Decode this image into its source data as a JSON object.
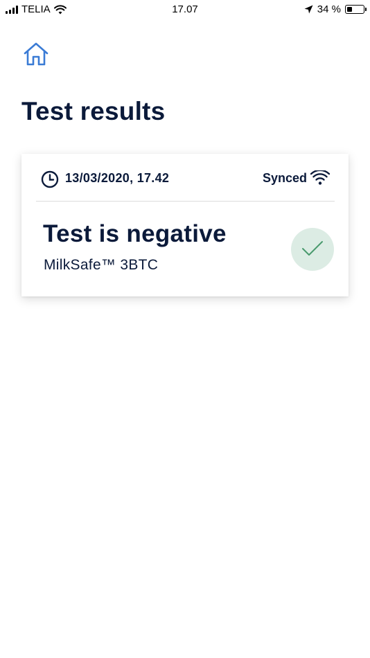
{
  "status_bar": {
    "carrier": "TELIA",
    "time": "17.07",
    "battery_text": "34 %",
    "battery_level": 0.34,
    "icons": [
      "signal-icon",
      "wifi-icon",
      "location-arrow-icon",
      "battery-icon"
    ]
  },
  "nav": {
    "home_icon": "home-icon"
  },
  "page": {
    "title": "Test results"
  },
  "result_card": {
    "timestamp": "13/03/2020, 17.42",
    "sync_status": "Synced",
    "result": "Test is negative",
    "product": "MilkSafe™ 3BTC",
    "icons": [
      "clock-icon",
      "wifi-icon",
      "checkmark-icon"
    ]
  },
  "colors": {
    "title_text": "#0b1a3a",
    "home_icon": "#3a7bd5",
    "check_badge_bg": "#dcece4",
    "check_mark": "#4a9a6e",
    "divider": "#dcdcdc"
  }
}
